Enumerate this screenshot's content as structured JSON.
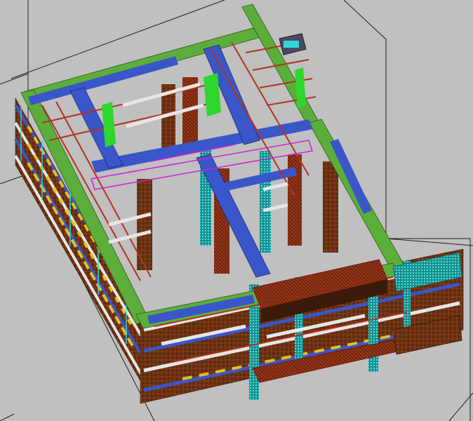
{
  "viewport": {
    "background": "#c0c0c0",
    "projection": "isometric",
    "colors": {
      "green_beam": "#5cae3a",
      "blue_beam": "#3a56c8",
      "red_framing": "#b4321e",
      "brown_panel": "#5a2e10",
      "cyan_member": "#34d6d6",
      "yellow_member": "#e2c020",
      "white_member": "#e6e6e6",
      "magenta_outline": "#d020d0",
      "bright_green": "#2ed62e",
      "bounding_line": "#202020"
    },
    "components": [
      "bounding-box",
      "outer-frame-beam",
      "inner-cross-beam",
      "column",
      "formwork-panel",
      "brace",
      "anchor-plate"
    ]
  }
}
